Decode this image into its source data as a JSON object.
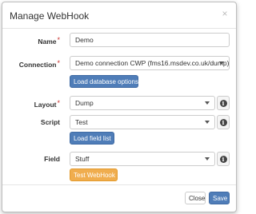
{
  "modal": {
    "title": "Manage WebHook",
    "close_glyph": "×"
  },
  "form": {
    "name": {
      "label": "Name",
      "value": "Demo",
      "required_mark": "*"
    },
    "connection": {
      "label": "Connection",
      "value": "Demo connection CWP (fms16.msdev.co.uk/dump)",
      "required_mark": "*"
    },
    "load_database_button": "Load database options",
    "layout": {
      "label": "Layout",
      "value": "Dump",
      "required_mark": "*"
    },
    "script": {
      "label": "Script",
      "value": "Test"
    },
    "load_field_button": "Load field list",
    "field": {
      "label": "Field",
      "value": "Stuff"
    },
    "test_button": "Test WebHook",
    "info_glyph": "i"
  },
  "footer": {
    "close_label": "Close",
    "save_label": "Save"
  },
  "colors": {
    "primary": "#4f7db8",
    "warning": "#f0ad4e",
    "required": "#c9302c"
  }
}
